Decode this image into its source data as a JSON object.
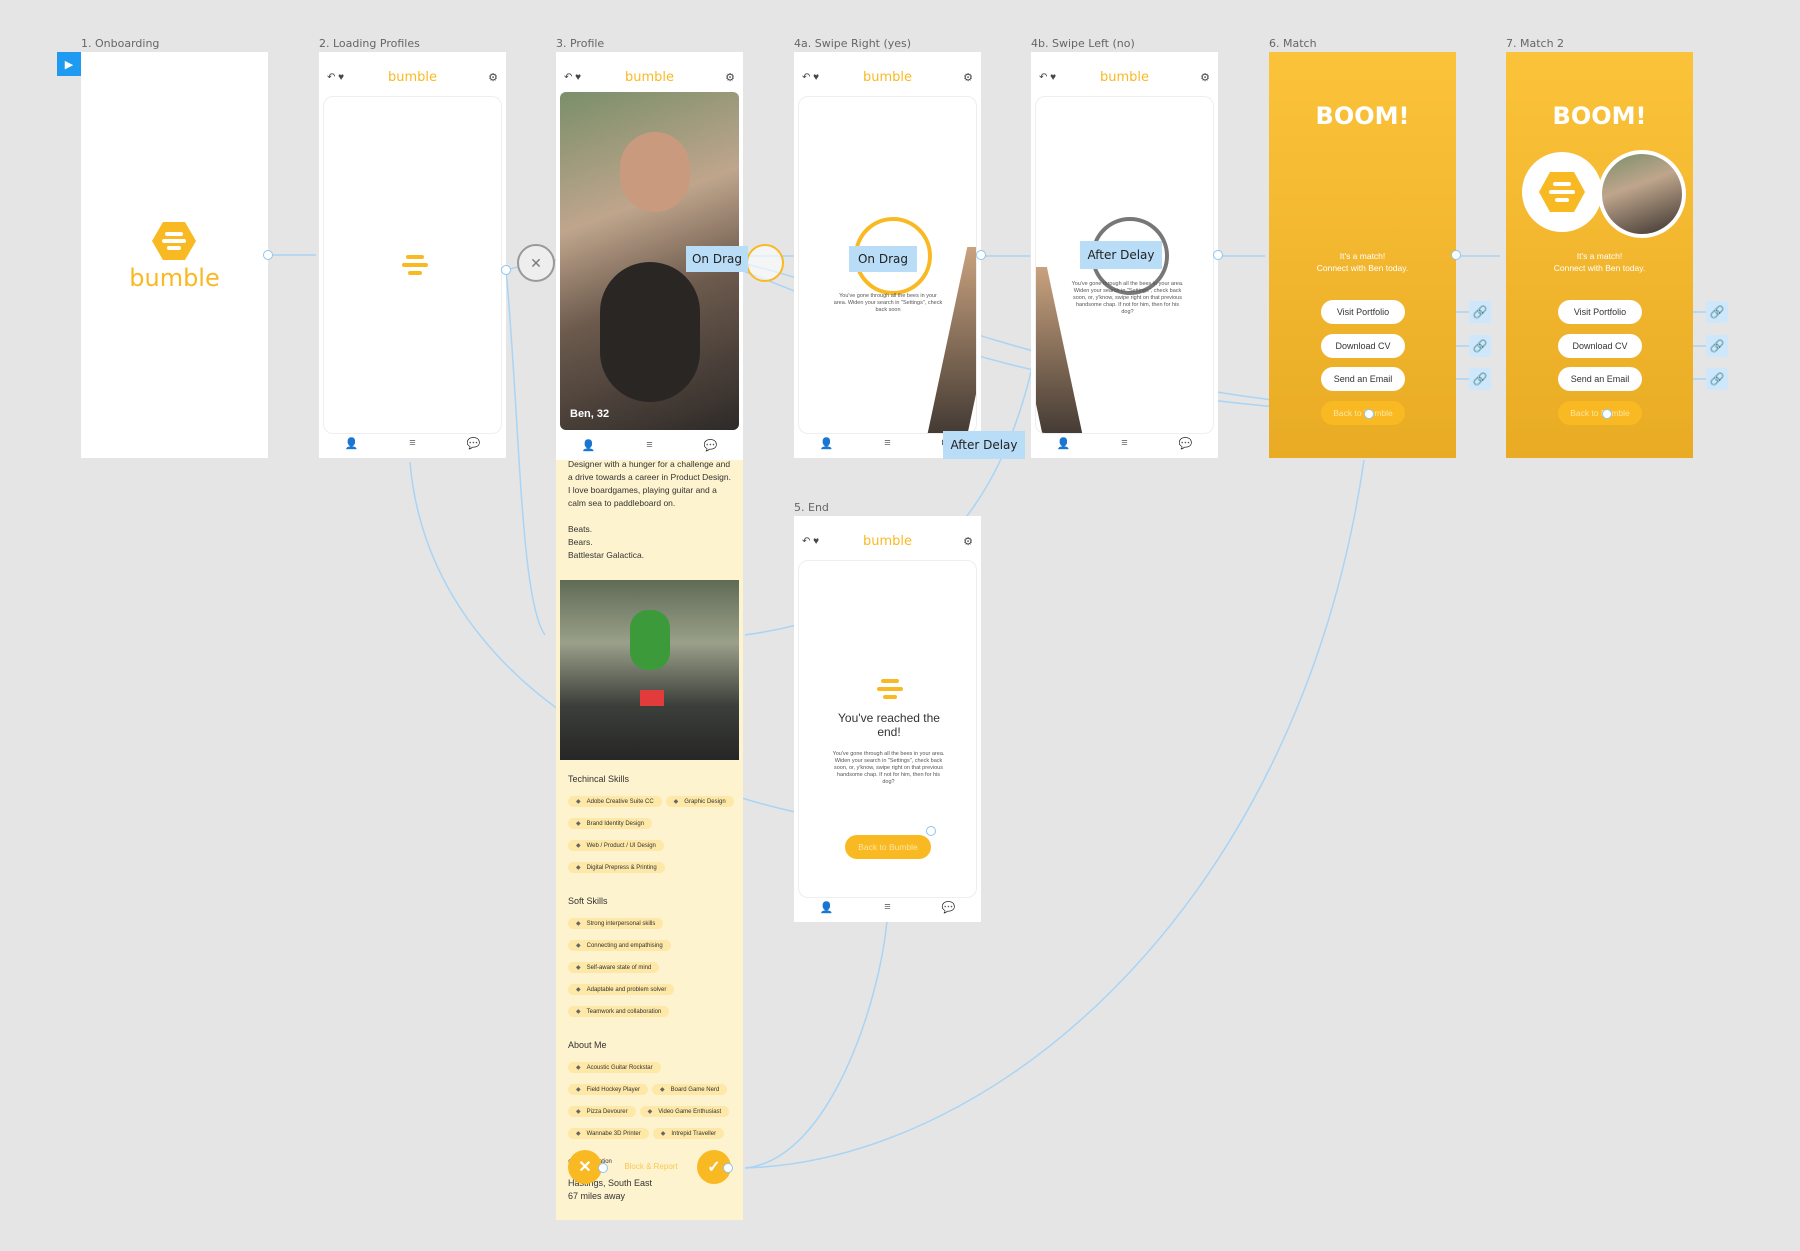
{
  "labels": {
    "f1": "1. Onboarding",
    "f2": "2. Loading Profiles",
    "f3": "3. Profile",
    "f4a": "4a. Swipe Right (yes)",
    "f4b": "4b. Swipe Left (no)",
    "f6": "6. Match",
    "f7": "7. Match 2",
    "f5": "5. End"
  },
  "brand": "bumble",
  "header": {
    "back_icon": "undo-icon",
    "heart_icon": "heart-icon",
    "filter_icon": "filter-icon"
  },
  "profile": {
    "name_age": "Ben, 32",
    "bio_1": "Designer with a hunger for a challenge and a drive towards a career in Product Design.",
    "bio_2": "I love boardgames, playing guitar and a calm sea to paddleboard on.",
    "bio_3": "Beats.",
    "bio_4": "Bears.",
    "bio_5": "Battlestar Galactica.",
    "tech_title": "Techincal Skills",
    "tech": [
      "Adobe Creative Suite CC",
      "Graphic Design",
      "Brand Identity Design",
      "Web / Product / UI Design",
      "Digital Prepress & Printing"
    ],
    "soft_title": "Soft Skills",
    "soft": [
      "Strong interpersonal skills",
      "Connecting and empathising",
      "Self-aware state of mind",
      "Adaptable and problem solver",
      "Teamwork and collaboration"
    ],
    "about_title": "About Me",
    "about": [
      "Acoustic Guitar Rockstar",
      "Field Hockey Player",
      "Board Game Nerd",
      "Pizza Devourer",
      "Video Game Enthusiast",
      "Wannabe 3D Printer",
      "Intrepid Traveller"
    ],
    "location_label": "Ben's location",
    "location": "Hastings, South East",
    "distance": "67 miles away",
    "block_report": "Block & Report"
  },
  "swipe_text": "You've gone through all the bees in your area. Widen your search in \"Settings\", check back soon, or, y'know, swipe right on that previous handsome chap. If not for him, then for his dog?",
  "swipe_partial": "You've gone through all the bees in your area. Widen your search in \"Settings\", check back soon",
  "end": {
    "title": "You've reached the end!",
    "body": "You've gone through all the bees in your area. Widen your search in \"Settings\", check back soon, or, y'know, swipe right on that previous handsome chap. If not for him, then for his dog?",
    "button": "Back to Bumble"
  },
  "match": {
    "boom": "BOOM!",
    "line1": "It's a match!",
    "line2": "Connect with Ben today.",
    "visit": "Visit Portfolio",
    "cv": "Download CV",
    "email": "Send an Email",
    "back": "Back to Bumble"
  },
  "proto": {
    "on_drag": "On Drag",
    "after_delay": "After Delay",
    "profile_drag": "On Drag"
  },
  "colors": {
    "bumble_yellow": "#f9b923",
    "wire_blue": "#8cc6f0",
    "proto_blue": "#b9dcf7"
  }
}
